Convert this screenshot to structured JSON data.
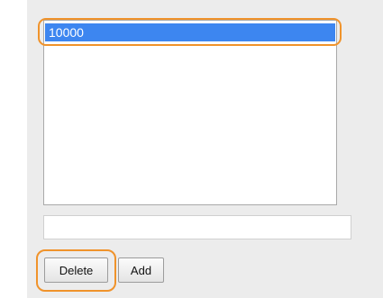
{
  "list": {
    "items": [
      {
        "label": "10000",
        "selected": true
      }
    ]
  },
  "input": {
    "value": "",
    "placeholder": ""
  },
  "buttons": {
    "delete_label": "Delete",
    "add_label": "Add"
  },
  "colors": {
    "selection": "#3d86f0",
    "highlight_ring": "#f0932b",
    "panel_background": "#ececec"
  }
}
